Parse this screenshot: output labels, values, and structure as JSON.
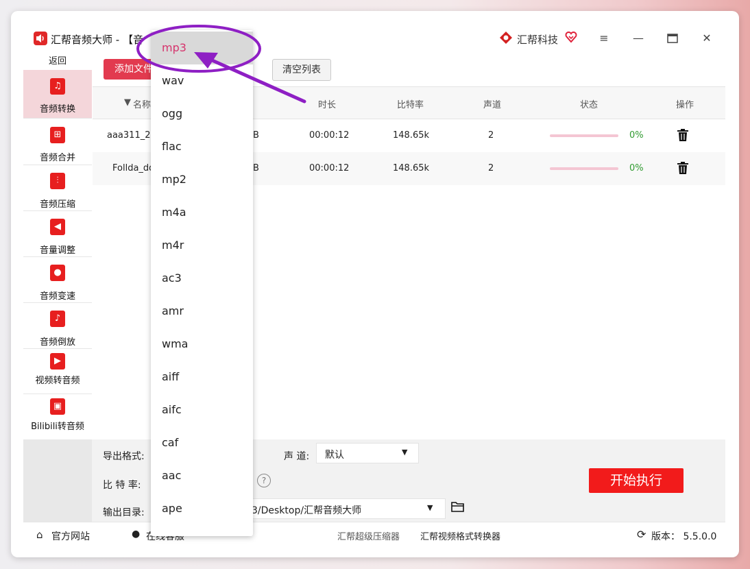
{
  "window": {
    "app_title": "汇帮音频大师  -  【音",
    "brand": "汇帮科技",
    "icons": {
      "menu": "menu-icon",
      "minimize": "minimize-icon",
      "maximize": "maximize-icon",
      "close": "close-icon"
    }
  },
  "sidebar": {
    "back": "返回",
    "items": [
      {
        "label": "音频转换",
        "active": true,
        "icon": "audio-convert-icon"
      },
      {
        "label": "音频合并",
        "icon": "audio-merge-icon"
      },
      {
        "label": "音频压缩",
        "icon": "audio-compress-icon"
      },
      {
        "label": "音量调整",
        "icon": "volume-icon"
      },
      {
        "label": "音频变速",
        "icon": "microphone-icon"
      },
      {
        "label": "音频倒放",
        "icon": "music-note-icon"
      },
      {
        "label": "视频转音频",
        "icon": "film-icon"
      },
      {
        "label": "Bilibili转音频",
        "icon": "tv-icon"
      }
    ]
  },
  "toolbar": {
    "add_files": "添加文件",
    "clear_list": "清空列表"
  },
  "table": {
    "headers": {
      "name": "名称",
      "duration": "时长",
      "bitrate": "比特率",
      "channels": "声道",
      "status": "状态",
      "action": "操作"
    },
    "rows": [
      {
        "name": "aaa311_200",
        "size_tail": "B",
        "duration": "00:00:12",
        "bitrate": "148.65k",
        "channels": "2",
        "progress": "0%"
      },
      {
        "name": "Follda_dd",
        "size_tail": "B",
        "duration": "00:00:12",
        "bitrate": "148.65k",
        "channels": "2",
        "progress": "0%"
      }
    ]
  },
  "settings": {
    "format_label": "导出格式:",
    "channel_label": "声 道:",
    "channel_value": "默认",
    "bitrate_label": "比 特 率:",
    "output_label": "输出目录:",
    "output_value": "3/Desktop/汇帮音频大师",
    "start": "开始执行"
  },
  "footer": {
    "website": "官方网站",
    "online": "在线客服",
    "compressor": "汇帮超级压缩器",
    "video_converter": "汇帮视频格式转换器",
    "version": "版本： 5.5.0.0"
  },
  "dropdown": {
    "selected": "mp3",
    "options": [
      "mp3",
      "wav",
      "ogg",
      "flac",
      "mp2",
      "m4a",
      "m4r",
      "ac3",
      "amr",
      "wma",
      "aiff",
      "aifc",
      "caf",
      "aac",
      "ape"
    ]
  },
  "annotation_colors": {
    "highlight": "#8e1fc4",
    "accent": "#e23a4f"
  }
}
